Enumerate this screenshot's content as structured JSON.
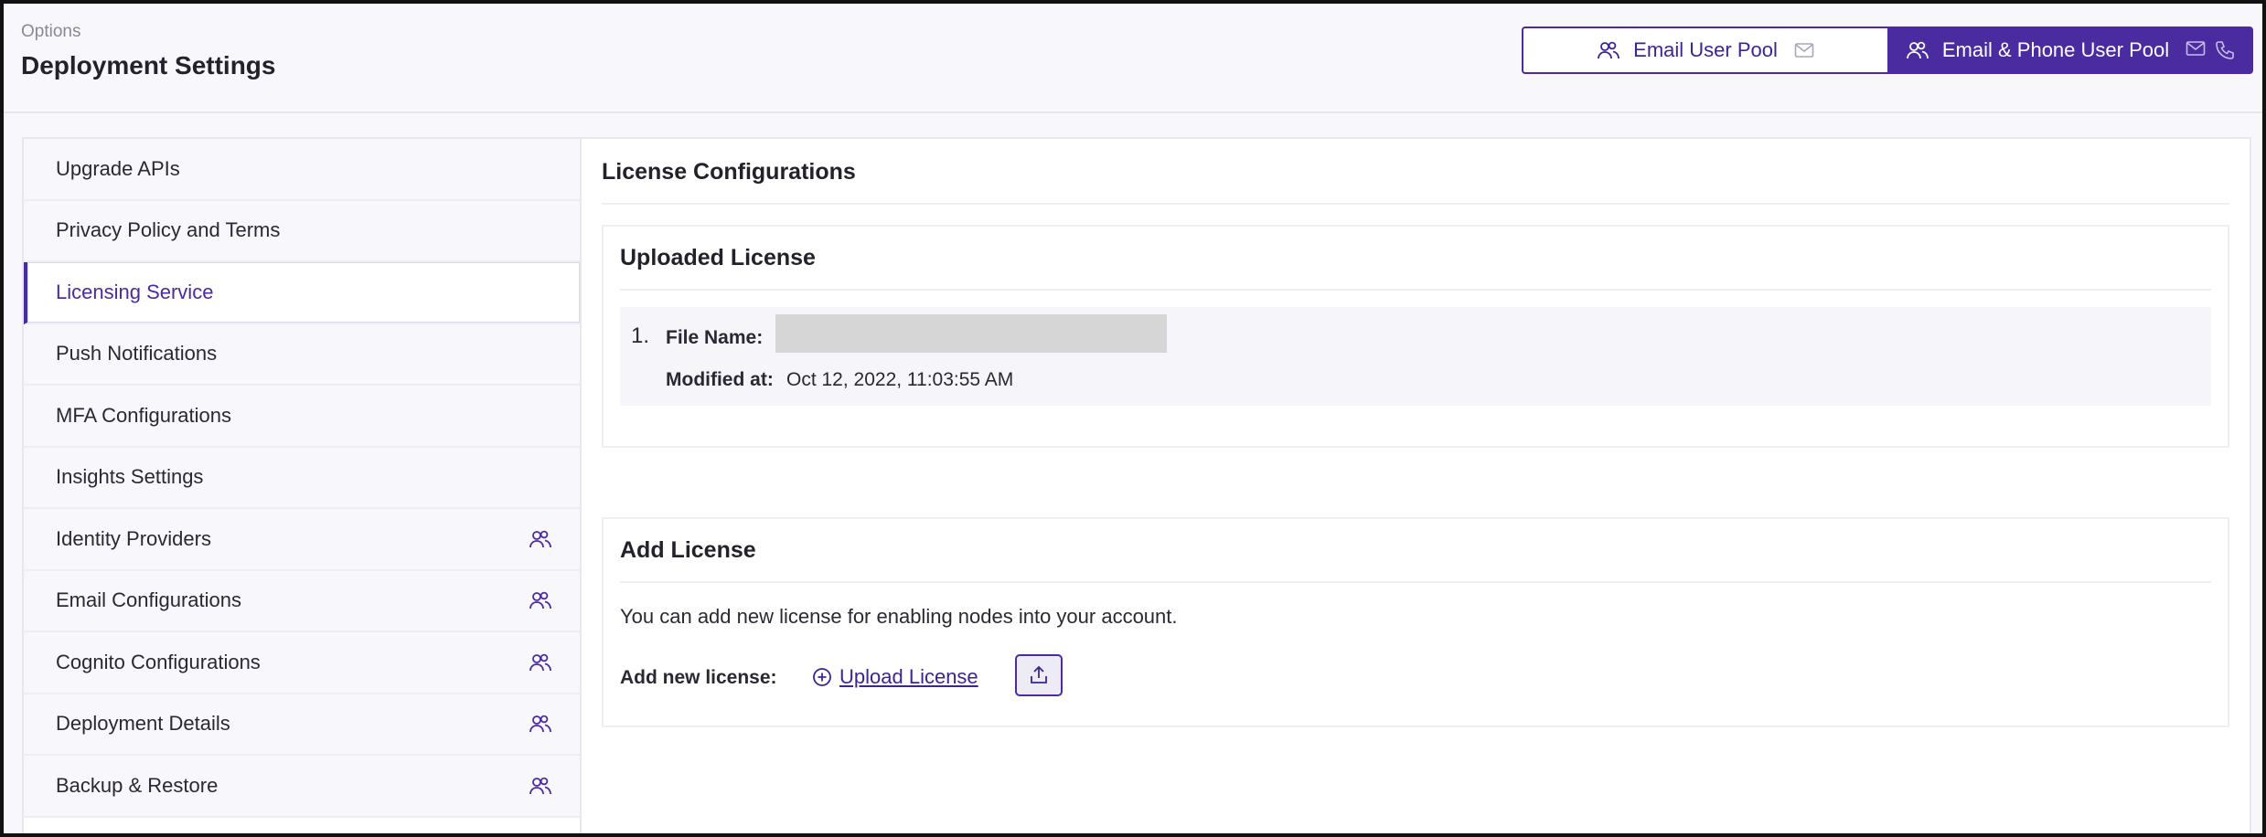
{
  "header": {
    "breadcrumb": "Options",
    "title": "Deployment Settings"
  },
  "pool_switch": {
    "email_label": "Email User Pool",
    "phone_label": "Email & Phone User Pool",
    "selected": "Email & Phone User Pool"
  },
  "sidebar": {
    "items": [
      {
        "label": "Upgrade APIs"
      },
      {
        "label": "Privacy Policy and Terms"
      },
      {
        "label": "Licensing Service"
      },
      {
        "label": "Push Notifications"
      },
      {
        "label": "MFA Configurations"
      },
      {
        "label": "Insights Settings"
      },
      {
        "label": "Identity Providers",
        "icon": "users-icon"
      },
      {
        "label": "Email Configurations",
        "icon": "users-icon"
      },
      {
        "label": "Cognito Configurations",
        "icon": "users-icon"
      },
      {
        "label": "Deployment Details",
        "icon": "users-icon"
      },
      {
        "label": "Backup & Restore",
        "icon": "users-icon"
      }
    ],
    "active": "Licensing Service"
  },
  "main": {
    "title": "License Configurations",
    "uploaded": {
      "title": "Uploaded License",
      "files": [
        {
          "index": "1.",
          "name_label": "File Name:",
          "modified_label": "Modified at:",
          "modified_value": "Oct 12, 2022, 11:03:55 AM"
        }
      ]
    },
    "add": {
      "title": "Add License",
      "description": "You can add new license for enabling nodes into your account.",
      "label": "Add new license:",
      "upload_link": "Upload License"
    }
  },
  "colors": {
    "accent": "#4a2ba0",
    "background": "#f8f7fc",
    "redacted": "#d6d6d6"
  }
}
